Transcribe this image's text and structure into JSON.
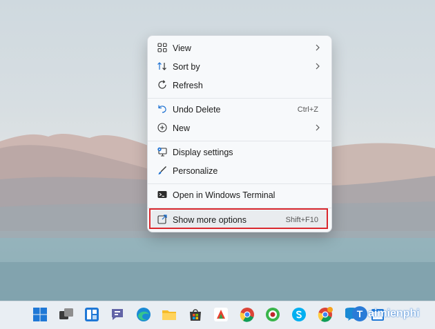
{
  "menu": {
    "items": [
      {
        "label": "View",
        "icon": "view-grid-icon",
        "submenu": true
      },
      {
        "label": "Sort by",
        "icon": "sort-icon",
        "submenu": true
      },
      {
        "label": "Refresh",
        "icon": "refresh-icon",
        "submenu": false
      },
      {
        "label": "Undo Delete",
        "icon": "undo-icon",
        "shortcut": "Ctrl+Z"
      },
      {
        "label": "New",
        "icon": "new-plus-icon",
        "submenu": true
      },
      {
        "label": "Display settings",
        "icon": "display-settings-icon"
      },
      {
        "label": "Personalize",
        "icon": "personalize-brush-icon"
      },
      {
        "label": "Open in Windows Terminal",
        "icon": "terminal-icon"
      },
      {
        "label": "Show more options",
        "icon": "show-more-options-icon",
        "shortcut": "Shift+F10",
        "highlighted": true
      }
    ]
  },
  "annotation": {
    "highlight_color": "#d9262c"
  },
  "taskbar": {
    "icons": [
      "start-icon",
      "task-view-icon",
      "widgets-icon",
      "teams-chat-icon",
      "edge-icon",
      "file-explorer-icon",
      "store-icon",
      "office-app-icon",
      "chrome-icon",
      "ccleaner-icon",
      "skype-icon",
      "chrome-alt-icon",
      "zalo-icon",
      "calendar-icon"
    ]
  },
  "watermark": {
    "letter": "T",
    "text": "aimienphi"
  },
  "colors": {
    "accent": "#2a7bd7",
    "menu_bg": "#f7f9fb"
  }
}
